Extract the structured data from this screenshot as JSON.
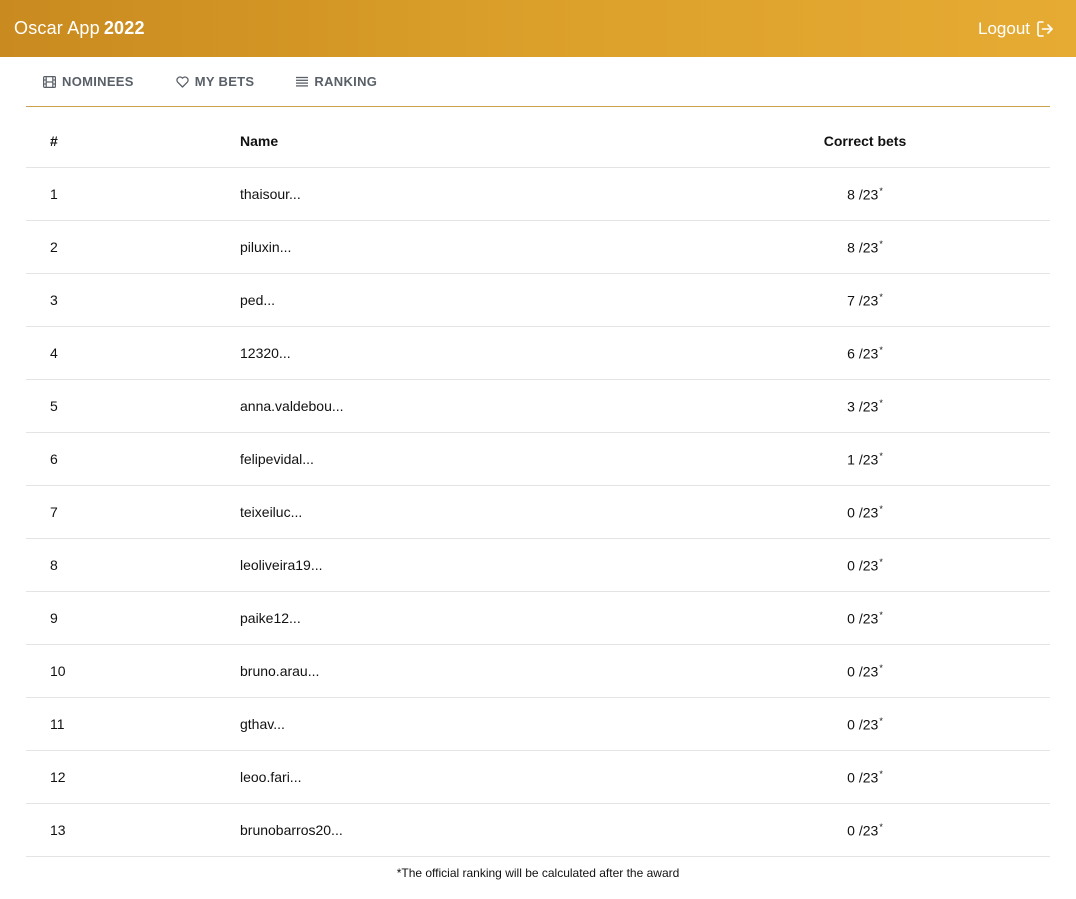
{
  "header": {
    "app_name": "Oscar App",
    "year": "2022",
    "logout_label": "Logout",
    "logout_icon": "logout-icon"
  },
  "tabs": [
    {
      "label": "NOMINEES",
      "icon": "film-icon"
    },
    {
      "label": "MY BETS",
      "icon": "heart-icon"
    },
    {
      "label": "RANKING",
      "icon": "list-icon"
    }
  ],
  "table": {
    "columns": [
      "#",
      "Name",
      "Correct bets"
    ],
    "rows": [
      {
        "rank": "1",
        "name": "thaisour...",
        "bets": "8 /23"
      },
      {
        "rank": "2",
        "name": "piluxin...",
        "bets": "8 /23"
      },
      {
        "rank": "3",
        "name": "ped...",
        "bets": "7 /23"
      },
      {
        "rank": "4",
        "name": "12320...",
        "bets": "6 /23"
      },
      {
        "rank": "5",
        "name": "anna.valdebou...",
        "bets": "3 /23"
      },
      {
        "rank": "6",
        "name": "felipevidal...",
        "bets": "1 /23"
      },
      {
        "rank": "7",
        "name": "teixeiluc...",
        "bets": "0 /23"
      },
      {
        "rank": "8",
        "name": "leoliveira19...",
        "bets": "0 /23"
      },
      {
        "rank": "9",
        "name": "paike12...",
        "bets": "0 /23"
      },
      {
        "rank": "10",
        "name": "bruno.arau...",
        "bets": "0 /23"
      },
      {
        "rank": "11",
        "name": "gthav...",
        "bets": "0 /23"
      },
      {
        "rank": "12",
        "name": "leoo.fari...",
        "bets": "0 /23"
      },
      {
        "rank": "13",
        "name": "brunobarros20...",
        "bets": "0 /23"
      }
    ],
    "asterisk": "*"
  },
  "footnote": "*The official ranking will be calculated after the award",
  "colors": {
    "header_gradient_start": "#c98a1f",
    "header_gradient_end": "#e6ab33",
    "tab_underline": "#c9a24a",
    "tab_text": "#5a6068"
  }
}
